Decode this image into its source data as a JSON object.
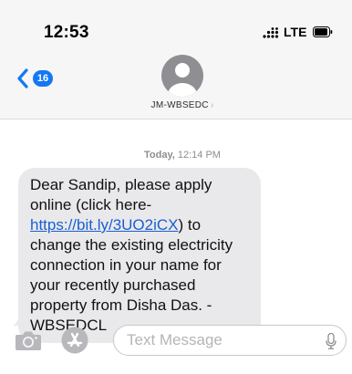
{
  "status_bar": {
    "time": "12:53",
    "network": "LTE"
  },
  "header": {
    "back_badge_count": "16",
    "contact_name": "JM-WBSEDC",
    "contact_chevron": "›"
  },
  "conversation": {
    "date_label": "Today,",
    "time_label": "12:14 PM",
    "message": {
      "text_before_link": "Dear Sandip, please apply online (click here- ",
      "link": "https://bit.ly/3UO2iCX",
      "text_after_link": ") to change the existing electricity connection in your name for your recently purchased property from Disha Das. -WBSEDCL"
    }
  },
  "composer": {
    "placeholder": "Text Message"
  },
  "icons": {
    "signal": "signal-dots-icon",
    "battery": "battery-icon",
    "back": "chevron-left-icon",
    "avatar": "person-avatar-icon",
    "camera": "camera-icon",
    "app_store": "app-store-icon",
    "mic": "microphone-icon"
  },
  "colors": {
    "accent_blue": "#1677f5",
    "bubble_gray": "#e9e9eb",
    "header_bg": "#f6f6f6"
  }
}
